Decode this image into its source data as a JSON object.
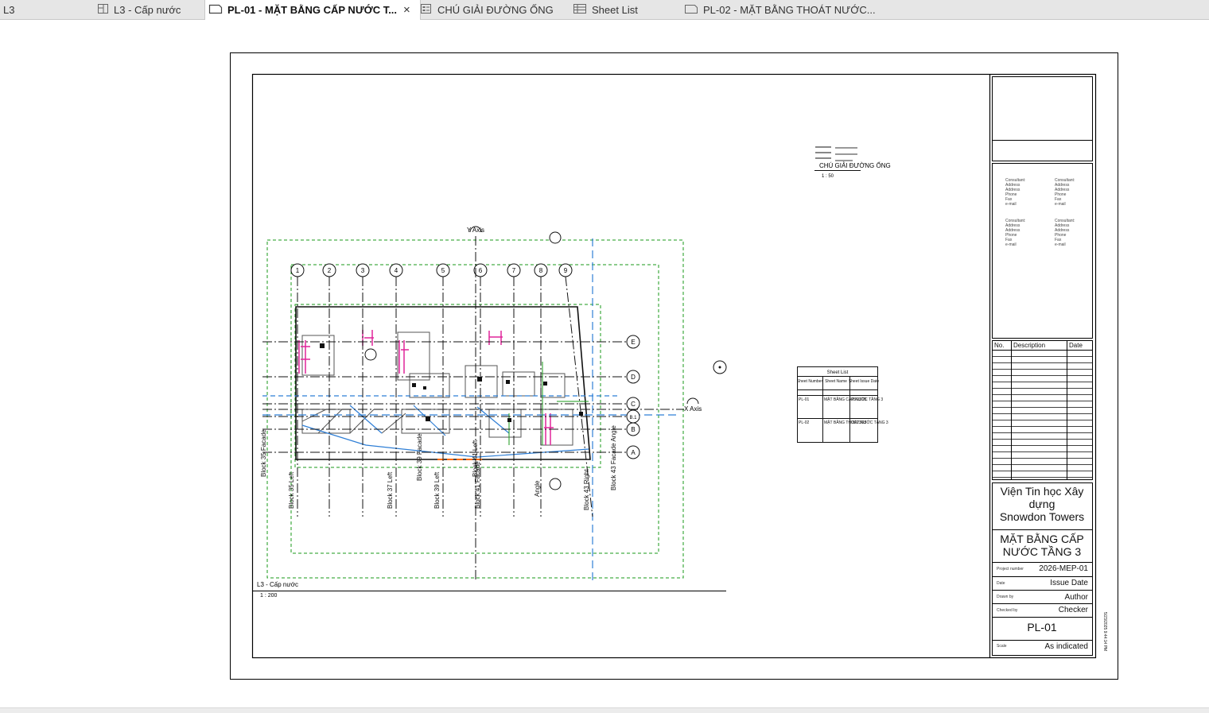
{
  "tabs": [
    {
      "label": "L3",
      "icon": "none",
      "active": false
    },
    {
      "label": "L3 - Cấp nước",
      "icon": "floor-plan-icon",
      "active": false
    },
    {
      "label": "PL-01 - MẶT BẰNG CẤP NƯỚC T...",
      "icon": "sheet-icon",
      "active": true
    },
    {
      "label": "CHÚ GIẢI ĐƯỜNG ỐNG",
      "icon": "legend-icon",
      "active": false
    },
    {
      "label": "Sheet List",
      "icon": "schedule-icon",
      "active": false
    },
    {
      "label": "PL-02 - MẶT BẰNG THOÁT NƯỚC...",
      "icon": "sheet-icon",
      "active": false
    }
  ],
  "close_glyph": "×",
  "plan": {
    "grids_numbers": [
      "1",
      "2",
      "3",
      "4",
      "5",
      "6",
      "7",
      "8",
      "9"
    ],
    "grids_letters": [
      "E",
      "D",
      "C",
      "B.1",
      "B",
      "A"
    ],
    "y_axis_label": "Y Axis",
    "x_axis_label": "X Axis",
    "wall_labels": [
      "Block 35 Facade",
      "Block 35 Left",
      "Block 37 Left",
      "Block 39 Facade",
      "Block 39 Left",
      "Block 41 Facade",
      "Block 41 Left",
      "Angle",
      "Block 43 Right",
      "Block 43 Facade Angle"
    ],
    "view_title": "L3 - Cấp nước",
    "view_scale": "1 : 200"
  },
  "legend_view": {
    "title": "CHÚ GIẢI ĐƯỜNG ỐNG",
    "scale": "1 : 50"
  },
  "sheet_list": {
    "title": "Sheet List",
    "headers": [
      "Sheet Number",
      "Sheet Name",
      "Sheet Issue Date"
    ],
    "rows": [
      [
        "PL-01",
        "MẶT BẰNG CẤP NƯỚC TẦNG 3",
        "05/23/25"
      ],
      [
        "PL-02",
        "MẶT BẰNG THOÁT NƯỚC TẦNG 3",
        "05/23/25"
      ]
    ]
  },
  "title_block": {
    "consultants": [
      [
        "Consultant:",
        "Address",
        "Address",
        "Phone",
        "Fax",
        "e-mail"
      ],
      [
        "Consultant:",
        "Address",
        "Address",
        "Phone",
        "Fax",
        "e-mail"
      ],
      [
        "Consultant:",
        "Address",
        "Address",
        "Phone",
        "Fax",
        "e-mail"
      ],
      [
        "Consultant:",
        "Address",
        "Address",
        "Phone",
        "Fax",
        "e-mail"
      ]
    ],
    "revision_headers": [
      "No.",
      "Description",
      "Date"
    ],
    "company": "Viện Tin học Xây dựng",
    "project": "Snowdon Towers",
    "sheet_title": "MẶT BẰNG CẤP NƯỚC TẦNG 3",
    "project_number_label": "Project number",
    "project_number": "2026-MEP-01",
    "date_label": "Date",
    "date_value": "Issue Date",
    "drawn_by_label": "Drawn by",
    "drawn_by": "Author",
    "checked_by_label": "Checked by",
    "checked_by": "Checker",
    "sheet_number": "PL-01",
    "scale_label": "Scale",
    "scale_value": "As indicated",
    "timestamp": "5/23/2025 9:44:14 PM"
  }
}
